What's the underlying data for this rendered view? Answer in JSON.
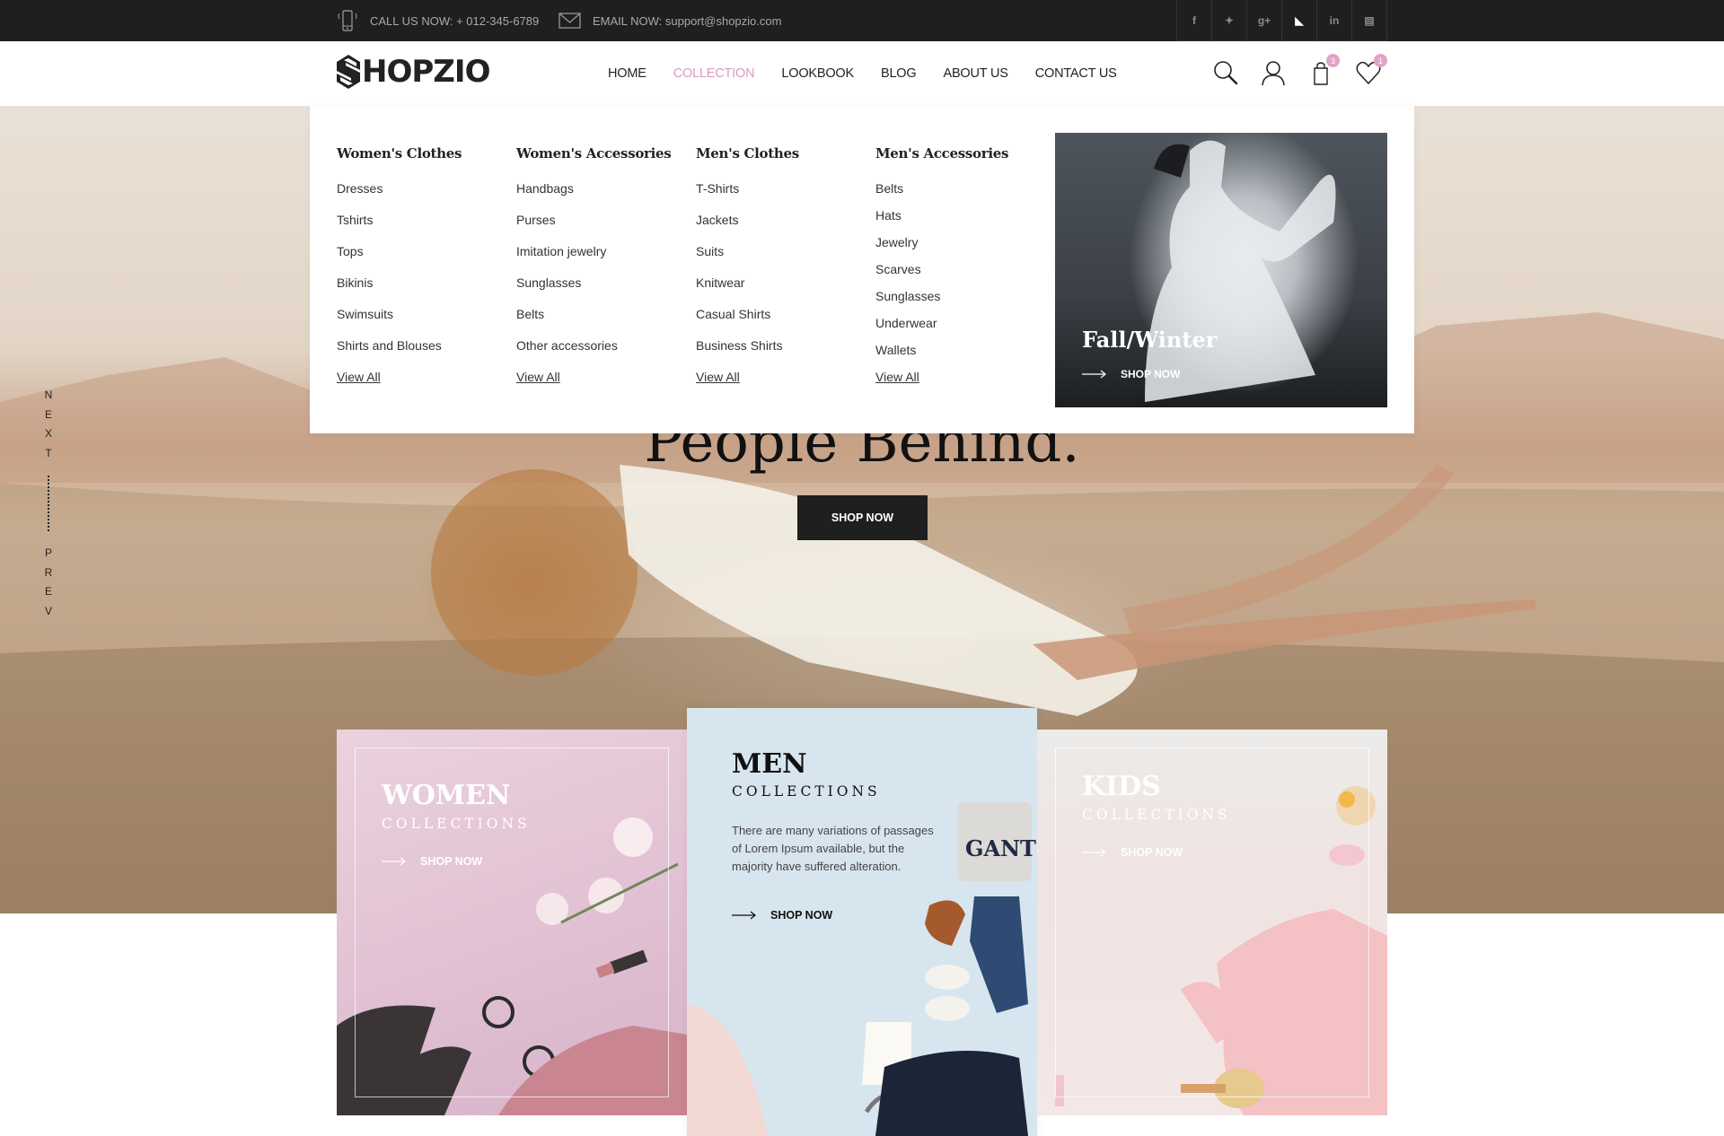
{
  "topbar": {
    "phone_label": "CALL US NOW: + 012-345-6789",
    "email_label": "EMAIL NOW: support@shopzio.com",
    "social": [
      "facebook-icon",
      "twitter-icon",
      "google-plus-icon",
      "rss-icon",
      "linkedin-icon",
      "youtube-icon"
    ],
    "social_glyphs": [
      "f",
      "✦",
      "g+",
      "◣",
      "in",
      "▤"
    ]
  },
  "header": {
    "logo": "HOPZIO",
    "nav": [
      "HOME",
      "COLLECTION",
      "LOOKBOOK",
      "BLOG",
      "ABOUT US",
      "CONTACT US"
    ],
    "active_nav": "COLLECTION",
    "cart_count": "3",
    "wishlist_count": "1",
    "accent_color": "#d79bc2"
  },
  "mega_menu": {
    "columns": [
      {
        "title": "Women's Clothes",
        "items": [
          "Dresses",
          "Tshirts",
          "Tops",
          "Bikinis",
          "Swimsuits",
          "Shirts and Blouses"
        ],
        "view_all": "View All"
      },
      {
        "title": "Women's Accessories",
        "items": [
          "Handbags",
          "Purses",
          "Imitation jewelry",
          "Sunglasses",
          "Belts",
          "Other accessories"
        ],
        "view_all": "View All"
      },
      {
        "title": "Men's Clothes",
        "items": [
          "T-Shirts",
          "Jackets",
          "Suits",
          "Knitwear",
          "Casual Shirts",
          "Business Shirts"
        ],
        "view_all": "View All"
      },
      {
        "title": "Men's Accessories",
        "items": [
          "Belts",
          "Hats",
          "Jewelry",
          "Scarves",
          "Sunglasses",
          "Underwear",
          "Wallets"
        ],
        "view_all": "View All"
      }
    ],
    "promo": {
      "title": "Fall/Winter",
      "cta": "SHOP NOW"
    }
  },
  "hero": {
    "title": "People Behind.",
    "cta": "SHOP NOW",
    "next": [
      "N",
      "E",
      "X",
      "T"
    ],
    "prev": [
      "P",
      "R",
      "E",
      "V"
    ]
  },
  "collections": [
    {
      "title": "WOMEN",
      "subtitle": "COLLECTIONS",
      "cta": "SHOP NOW"
    },
    {
      "title": "MEN",
      "subtitle": "COLLECTIONS",
      "description": "There are many variations of passages of Lorem Ipsum available, but the majority have suffered alteration.",
      "cta": "SHOP NOW"
    },
    {
      "title": "KIDS",
      "subtitle": "COLLECTIONS",
      "cta": "SHOP NOW"
    }
  ]
}
